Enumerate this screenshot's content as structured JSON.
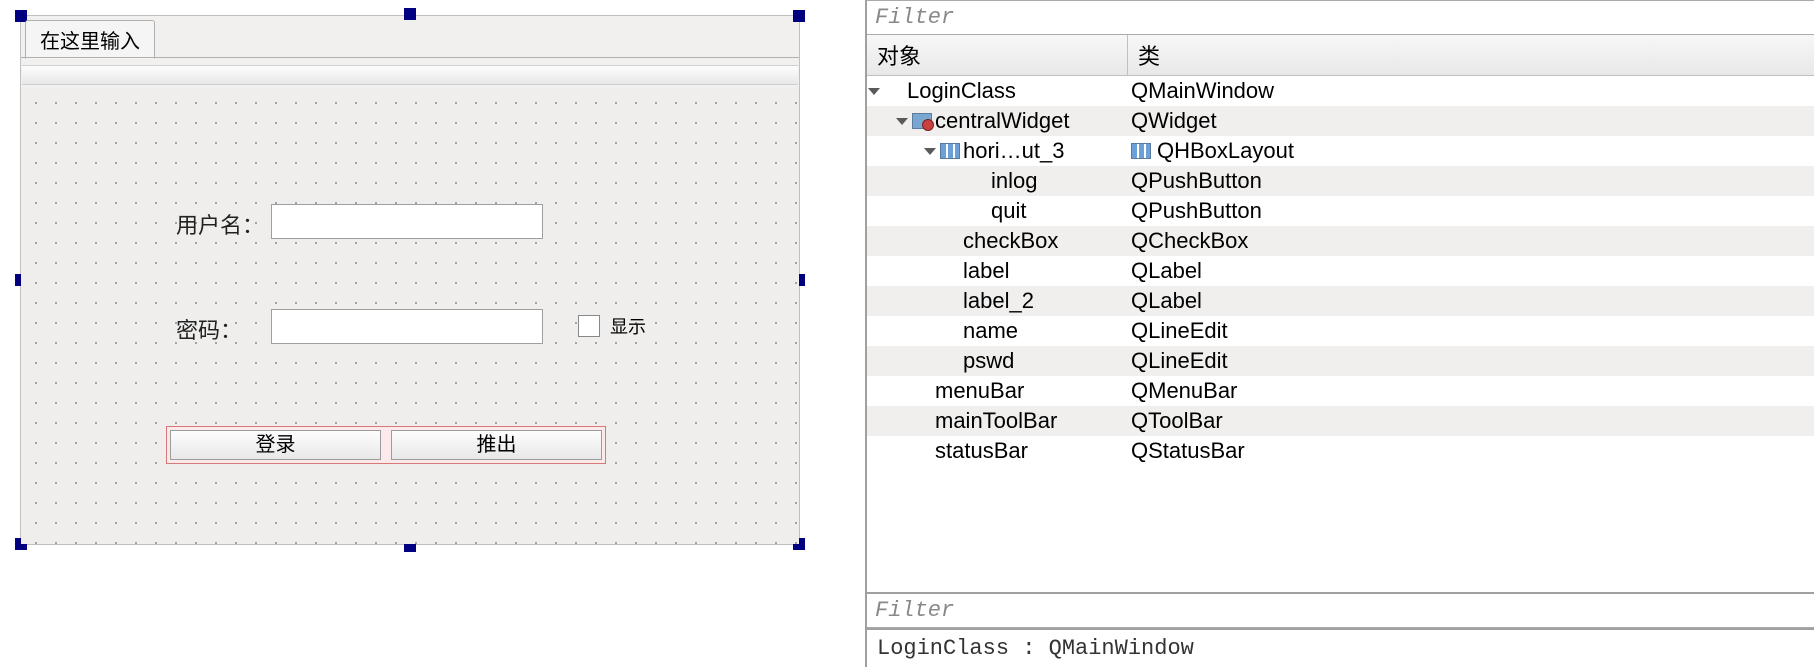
{
  "form": {
    "tab_label": "在这里输入",
    "username_label": "用户名：",
    "password_label": "密码：",
    "show_checkbox_label": "显示",
    "login_button_label": "登录",
    "quit_button_label": "推出"
  },
  "inspector": {
    "filter_placeholder": "Filter",
    "header_object": "对象",
    "header_class": "类",
    "rows": [
      {
        "indent": 0,
        "expander": true,
        "icon": "",
        "name": "LoginClass",
        "class": "QMainWindow",
        "classIcon": ""
      },
      {
        "indent": 1,
        "expander": true,
        "icon": "widget",
        "name": "centralWidget",
        "class": "QWidget",
        "classIcon": ""
      },
      {
        "indent": 2,
        "expander": true,
        "icon": "layout",
        "name": "hori…ut_3",
        "class": "QHBoxLayout",
        "classIcon": "layout"
      },
      {
        "indent": 3,
        "expander": false,
        "icon": "",
        "name": "inlog",
        "class": "QPushButton",
        "classIcon": ""
      },
      {
        "indent": 3,
        "expander": false,
        "icon": "",
        "name": "quit",
        "class": "QPushButton",
        "classIcon": ""
      },
      {
        "indent": 2,
        "expander": false,
        "icon": "",
        "name": "checkBox",
        "class": "QCheckBox",
        "classIcon": ""
      },
      {
        "indent": 2,
        "expander": false,
        "icon": "",
        "name": "label",
        "class": "QLabel",
        "classIcon": ""
      },
      {
        "indent": 2,
        "expander": false,
        "icon": "",
        "name": "label_2",
        "class": "QLabel",
        "classIcon": ""
      },
      {
        "indent": 2,
        "expander": false,
        "icon": "",
        "name": "name",
        "class": "QLineEdit",
        "classIcon": ""
      },
      {
        "indent": 2,
        "expander": false,
        "icon": "",
        "name": "pswd",
        "class": "QLineEdit",
        "classIcon": ""
      },
      {
        "indent": 1,
        "expander": false,
        "icon": "",
        "name": "menuBar",
        "class": "QMenuBar",
        "classIcon": ""
      },
      {
        "indent": 1,
        "expander": false,
        "icon": "",
        "name": "mainToolBar",
        "class": "QToolBar",
        "classIcon": ""
      },
      {
        "indent": 1,
        "expander": false,
        "icon": "",
        "name": "statusBar",
        "class": "QStatusBar",
        "classIcon": ""
      }
    ],
    "filter2_placeholder": "Filter",
    "status_line": "LoginClass : QMainWindow"
  }
}
